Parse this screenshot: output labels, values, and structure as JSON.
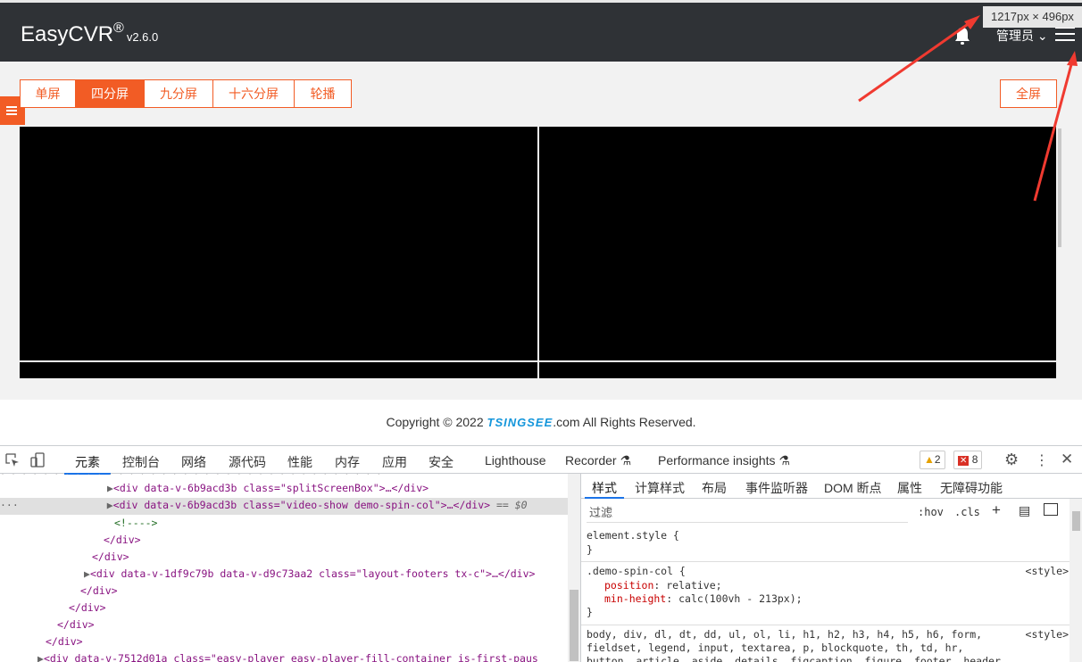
{
  "app": {
    "brand": "EasyCVR",
    "brand_reg": "®",
    "version": "v2.6.0",
    "user": "管理员",
    "user_caret": "⌄"
  },
  "size_tooltip": "1217px × 496px",
  "toolbar": {
    "tabs": [
      {
        "label": "单屏",
        "active": false
      },
      {
        "label": "四分屏",
        "active": true
      },
      {
        "label": "九分屏",
        "active": false
      },
      {
        "label": "十六分屏",
        "active": false
      },
      {
        "label": "轮播",
        "active": false
      }
    ],
    "fullscreen_label": "全屏"
  },
  "footer": {
    "prefix": "Copyright © 2022 ",
    "brand": "TSINGSEE",
    "suffix": ".com All Rights Reserved."
  },
  "devtools": {
    "tabs": [
      "元素",
      "控制台",
      "网络",
      "源代码",
      "性能",
      "内存",
      "应用",
      "安全",
      "Lighthouse",
      "Recorder ⚗",
      "Performance insights ⚗"
    ],
    "warnings": "2",
    "errors": "8",
    "elements": [
      {
        "indent": 120,
        "text": "<div data-v-6b9acd3b class=\"splitScreenBox\">…</div>"
      },
      {
        "indent": 120,
        "text": "<div data-v-6b9acd3b class=\"video-show demo-spin-col\">…</div>",
        "suffix": " == $0"
      },
      {
        "indent": 128,
        "text": "<!---->"
      },
      {
        "indent": 116,
        "text": "</div>"
      },
      {
        "indent": 103,
        "text": "</div>"
      },
      {
        "indent": 94,
        "text": "<div data-v-1df9c79b data-v-d9c73aa2 class=\"layout-footers tx-c\">…</div>"
      },
      {
        "indent": 90,
        "text": "</div>"
      },
      {
        "indent": 77,
        "text": "</div>"
      },
      {
        "indent": 64,
        "text": "</div>"
      },
      {
        "indent": 51,
        "text": "</div>"
      },
      {
        "indent": 42,
        "text": "<div data-v-7512d01a class=\"easy-player easy-player-fill-container is-first-paus"
      }
    ],
    "styles_tabs": [
      "样式",
      "计算样式",
      "布局",
      "事件监听器",
      "DOM 断点",
      "属性",
      "无障碍功能"
    ],
    "filter_placeholder": "过滤",
    "hov": ":hov",
    "cls": ".cls",
    "element_style": "element.style {",
    "close_brace": "}",
    "rule_selector": ".demo-spin-col {",
    "rule_source": "<style>",
    "rule_props": [
      {
        "name": "position",
        "value": "relative;"
      },
      {
        "name": "min-height",
        "value": "calc(100vh - 213px);"
      }
    ],
    "body_rule_lines": [
      "body, div, dl, dt, dd, ul, ol, li, h1, h2, h3, h4, h5, h6, form,",
      "fieldset, legend, input, textarea, p, blockquote, th, td, hr,",
      "button, article, aside, details, figcaption, figure, footer, header,"
    ]
  }
}
